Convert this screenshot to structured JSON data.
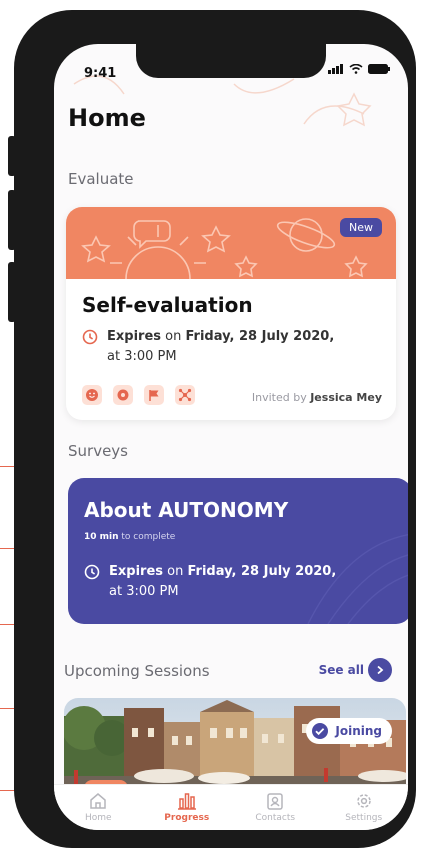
{
  "status_bar": {
    "time": "9:41"
  },
  "page": {
    "title": "Home"
  },
  "evaluate": {
    "section_title": "Evaluate",
    "badge": "New",
    "card_title": "Self-evaluation",
    "expires_prefix": "Expires",
    "expires_on": "on",
    "expires_date": "Friday, 28 July 2020,",
    "expires_at": "at 3:00 PM",
    "invited_prefix": "Invited by",
    "invited_name": "Jessica Mey",
    "tool_icons": [
      "smile-icon",
      "gear-icon",
      "flag-icon",
      "network-icon"
    ]
  },
  "surveys": {
    "section_title": "Surveys",
    "card_title": "About AUTONOMY",
    "duration": "10 min",
    "duration_suffix": "to complete",
    "expires_prefix": "Expires",
    "expires_on": "on",
    "expires_date": "Friday, 28 July 2020,",
    "expires_at": "at 3:00 PM"
  },
  "sessions": {
    "section_title": "Upcoming Sessions",
    "see_all": "See all",
    "status": "Joining"
  },
  "tabbar": {
    "items": [
      {
        "label": "Home",
        "icon": "home-icon"
      },
      {
        "label": "Progress",
        "icon": "bar-chart-icon"
      },
      {
        "label": "Contacts",
        "icon": "contact-card-icon"
      },
      {
        "label": "Settings",
        "icon": "gear-icon"
      }
    ],
    "active": "Progress"
  },
  "colors": {
    "accent_orange": "#f08662",
    "accent_indigo": "#4a4aa2",
    "frame": "#1a1a1a",
    "background": "#fbfafb"
  }
}
